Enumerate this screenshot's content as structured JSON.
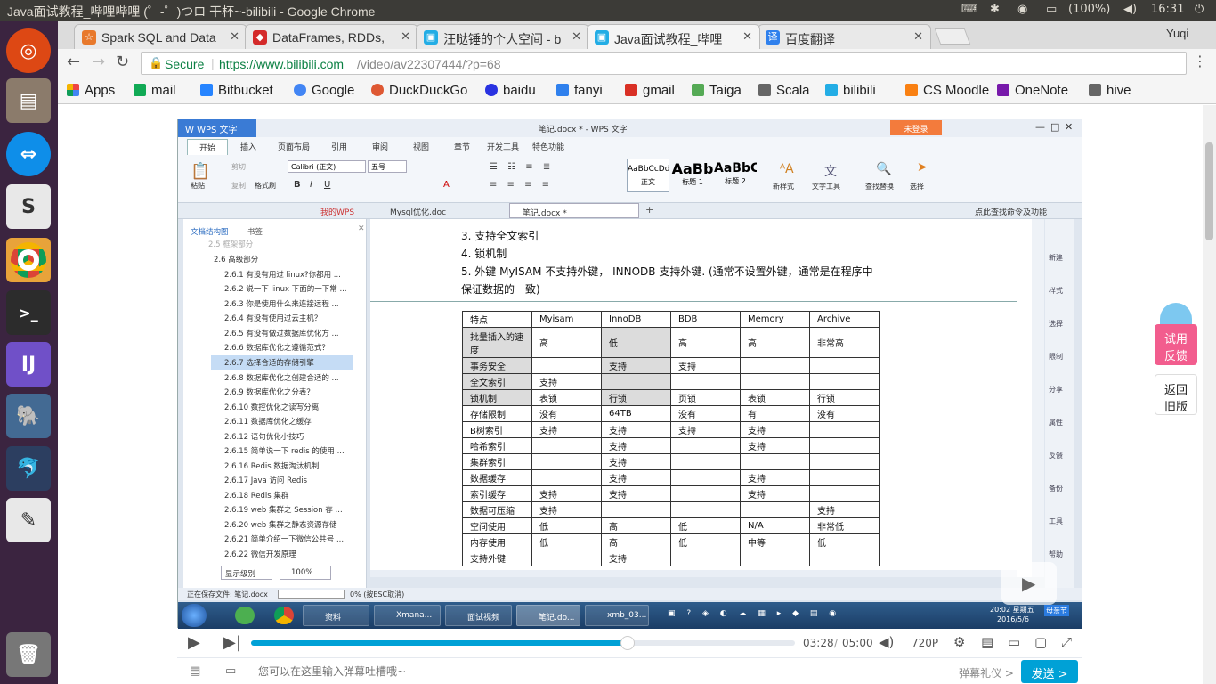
{
  "os": {
    "window_title": "Java面试教程_哔哩哔哩 (゜-゜)つロ 干杯~-bilibili - Google Chrome",
    "battery": "(100%)",
    "clock": "16:31",
    "launcher": [
      "ubuntu-icon",
      "files-icon",
      "teamviewer-icon",
      "slack-icon",
      "chrome-icon",
      "terminal-icon",
      "intellij-icon",
      "postgres-icon",
      "mysql-workbench-icon",
      "text-editor-icon",
      "trash-icon"
    ]
  },
  "chrome": {
    "tabs": [
      {
        "label": "Spark SQL and Data",
        "color": "#e8792c"
      },
      {
        "label": "DataFrames, RDDs,",
        "color": "#d42a2a"
      },
      {
        "label": "汪哒锤的个人空间 - b",
        "color": "#23ade5"
      },
      {
        "label": "Java面试教程_哔哩",
        "color": "#23ade5"
      },
      {
        "label": "百度翻译",
        "color": "#2f80ed"
      }
    ],
    "profile": "Yuqi",
    "secure_label": "Secure",
    "url_host": "https://www.bilibili.com",
    "url_path": "/video/av22307444/?p=68",
    "bookmarks": [
      {
        "label": "Apps",
        "color": "#e44"
      },
      {
        "label": "mail",
        "color": "#1a5"
      },
      {
        "label": "Bitbucket",
        "color": "#2684ff"
      },
      {
        "label": "Google",
        "color": "#4285f4"
      },
      {
        "label": "DuckDuckGo",
        "color": "#de5833"
      },
      {
        "label": "baidu",
        "color": "#2932e1"
      },
      {
        "label": "fanyi",
        "color": "#2f80ed"
      },
      {
        "label": "gmail",
        "color": "#d93025"
      },
      {
        "label": "Taiga",
        "color": "#555"
      },
      {
        "label": "Scala",
        "color": "#555"
      },
      {
        "label": "bilibili",
        "color": "#23ade5"
      },
      {
        "label": "CS Moodle",
        "color": "#f98012"
      },
      {
        "label": "OneNote",
        "color": "#7719aa"
      },
      {
        "label": "hive",
        "color": "#555"
      }
    ]
  },
  "wps": {
    "app_title": "W WPS 文字",
    "doc_title": "笔记.docx * - WPS 文字",
    "login_btn": "未登录",
    "ribbon_tabs": [
      "开始",
      "插入",
      "页面布局",
      "引用",
      "审阅",
      "视图",
      "章节",
      "开发工具",
      "特色功能"
    ],
    "font_name": "Calibri (正文)",
    "font_size": "五号",
    "styles": [
      {
        "preview": "AaBbCcDd",
        "name": "正文"
      },
      {
        "preview": "AaBb",
        "name": "标题 1"
      },
      {
        "preview": "AaBbC",
        "name": "标题 2"
      }
    ],
    "tools": [
      "新样式",
      "文字工具",
      "查找替换",
      "选择"
    ],
    "clipboard": [
      "粘贴",
      "剪切",
      "复制",
      "格式刷"
    ],
    "doc_tabs": [
      "我的WPS",
      "Mysql优化.doc",
      "笔记.docx *"
    ],
    "cmd_search": "点此查找命令及功能",
    "pane_tabs": [
      "文档结构图",
      "书签"
    ],
    "tree": [
      "2.5 框架部分",
      "2.6 高级部分",
      "2.6.1 有没有用过 linux?你都用 ...",
      "2.6.2 说一下 linux 下面的一下常 ...",
      "2.6.3 你是使用什么来连接远程 ...",
      "2.6.4 有没有使用过云主机？",
      "2.6.5 有没有做过数据库优化方 ...",
      "2.6.6 数据库优化之遵循范式？",
      "2.6.7 选择合适的存储引擎",
      "2.6.8 数据库优化之创建合适的 ...",
      "2.6.9 数据库优化之分表？",
      "2.6.10 数控优化之读写分离",
      "2.6.11 数据库优化之缓存",
      "2.6.12 语句优化小技巧",
      "2.6.15 简单说一下 redis 的使用 ...",
      "2.6.16 Redis 数据淘汰机制",
      "2.6.17 Java 访问 Redis",
      "2.6.18 Redis 集群",
      "2.6.19 web 集群之 Session 存 ...",
      "2.6.20 web 集群之静态资源存储",
      "2.6.21 简单介绍一下微信公共号 ...",
      "2.6.22 微信开发原理"
    ],
    "pane_footer": [
      "显示级别",
      "100%"
    ],
    "doc_lines": [
      "3.  支持全文索引",
      "4.  锁机制",
      "5.  外键  MyISAM  不支持外键，  INNODB 支持外键. (通常不设置外键，通常是在程序中",
      "保证数据的一致)"
    ],
    "table_header": [
      "特点",
      "Myisam",
      "InnoDB",
      "BDB",
      "Memory",
      "Archive"
    ],
    "table_rows": [
      [
        "批量插入的速度",
        "高",
        "低",
        "高",
        "高",
        "非常高"
      ],
      [
        "事务安全",
        "",
        "支持",
        "支持",
        "",
        ""
      ],
      [
        "全文索引",
        "支持",
        "",
        "",
        "",
        ""
      ],
      [
        "锁机制",
        "表锁",
        "行锁",
        "页锁",
        "表锁",
        "行锁"
      ],
      [
        "存储限制",
        "没有",
        "64TB",
        "没有",
        "有",
        "没有"
      ],
      [
        "B树索引",
        "支持",
        "支持",
        "支持",
        "支持",
        ""
      ],
      [
        "哈希索引",
        "",
        "支持",
        "",
        "支持",
        ""
      ],
      [
        "集群索引",
        "",
        "支持",
        "",
        "",
        ""
      ],
      [
        "数据缓存",
        "",
        "支持",
        "",
        "支持",
        ""
      ],
      [
        "索引缓存",
        "支持",
        "支持",
        "",
        "支持",
        ""
      ],
      [
        "数据可压缩",
        "支持",
        "",
        "",
        "",
        "支持"
      ],
      [
        "空间使用",
        "低",
        "高",
        "低",
        "N/A",
        "非常低"
      ],
      [
        "内存使用",
        "低",
        "高",
        "低",
        "中等",
        "低"
      ],
      [
        "支持外键",
        "",
        "支持",
        "",
        "",
        ""
      ]
    ],
    "right_tools": [
      "新建",
      "样式",
      "选择",
      "限制",
      "分享",
      "属性",
      "反馈",
      "备份",
      "工具",
      "帮助"
    ],
    "status_text": "正在保存文件: 笔记.docx",
    "status_pct": "0%  (按ESC取消)",
    "taskbar": [
      "资料",
      "Xmana...",
      "面试视频",
      "笔记.do...",
      "xmb_03..."
    ],
    "win_time": "20:02 星期五",
    "win_date": "2016/5/6",
    "win_badge": "母亲节"
  },
  "player": {
    "current": "03:28",
    "sep": "/",
    "total": "05:00",
    "quality": "720P",
    "progress": 0.693,
    "danmaku_placeholder": "您可以在这里输入弹幕吐槽哦~",
    "danmaku_etiquette": "弹幕礼仪 >",
    "send": "发送 >"
  },
  "side": {
    "trial_l1": "试用",
    "trial_l2": "反馈",
    "back_l1": "返回",
    "back_l2": "旧版"
  }
}
